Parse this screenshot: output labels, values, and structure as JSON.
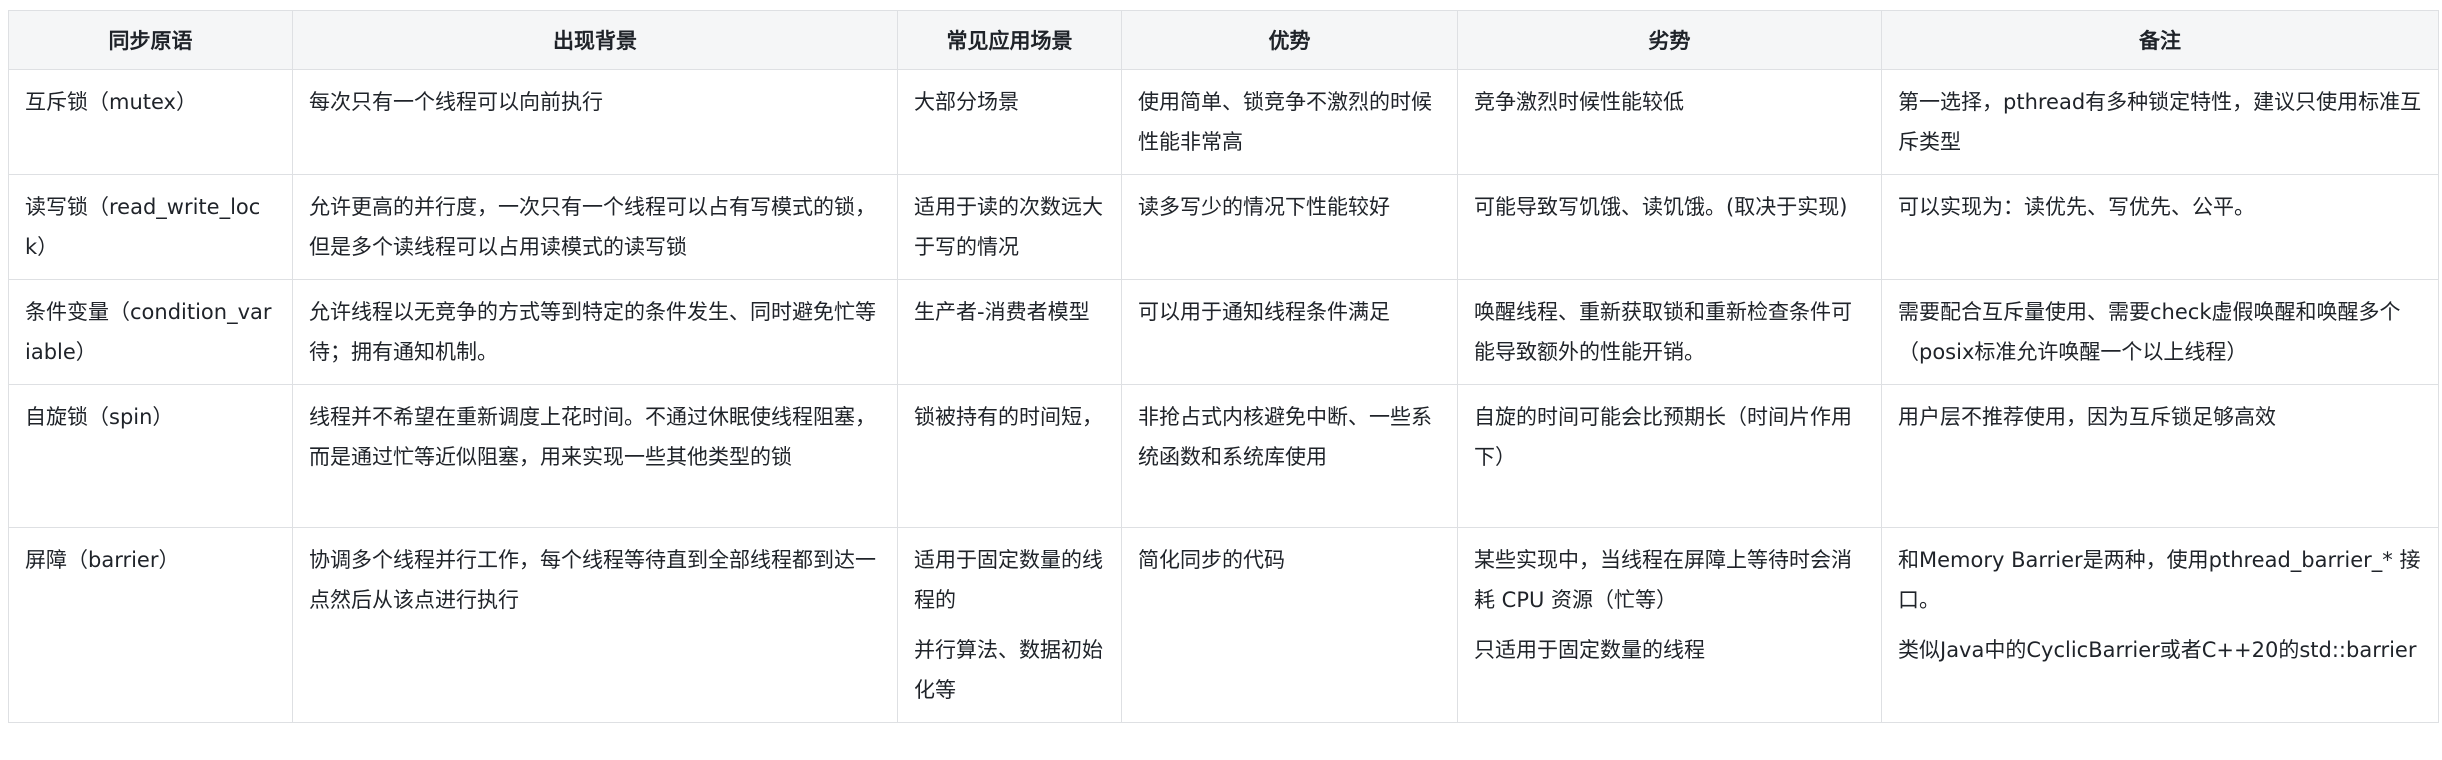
{
  "table": {
    "headers": [
      "同步原语",
      "出现背景",
      "常见应用场景",
      "优势",
      "劣势",
      "备注"
    ],
    "rows": [
      [
        [
          "互斥锁（mutex）"
        ],
        [
          "每次只有一个线程可以向前执行"
        ],
        [
          "大部分场景"
        ],
        [
          "使用简单、锁竞争不激烈的时候性能非常高"
        ],
        [
          "竞争激烈时候性能较低"
        ],
        [
          "第一选择，pthread有多种锁定特性，建议只使用标准互斥类型"
        ]
      ],
      [
        [
          "读写锁（read_write_lock）"
        ],
        [
          "允许更高的并行度，一次只有一个线程可以占有写模式的锁，但是多个读线程可以占用读模式的读写锁"
        ],
        [
          "适用于读的次数远大于写的情况"
        ],
        [
          "读多写少的情况下性能较好"
        ],
        [
          "可能导致写饥饿、读饥饿。(取决于实现)"
        ],
        [
          "可以实现为：读优先、写优先、公平。"
        ]
      ],
      [
        [
          "条件变量（condition_variable）"
        ],
        [
          "允许线程以无竞争的方式等到特定的条件发生、同时避免忙等待；拥有通知机制。"
        ],
        [
          "生产者-消费者模型"
        ],
        [
          "可以用于通知线程条件满足"
        ],
        [
          "唤醒线程、重新获取锁和重新检查条件可能导致额外的性能开销。"
        ],
        [
          "需要配合互斥量使用、需要check虚假唤醒和唤醒多个（posix标准允许唤醒一个以上线程）"
        ]
      ],
      [
        [
          "自旋锁（spin）"
        ],
        [
          "线程并不希望在重新调度上花时间。不通过休眠使线程阻塞，而是通过忙等近似阻塞，用来实现一些其他类型的锁"
        ],
        [
          "锁被持有的时间短，"
        ],
        [
          "非抢占式内核避免中断、一些系统函数和系统库使用"
        ],
        [
          "自旋的时间可能会比预期长（时间片作用下）"
        ],
        [
          "用户层不推荐使用，因为互斥锁足够高效"
        ]
      ],
      [
        [
          "屏障（barrier）"
        ],
        [
          "协调多个线程并行工作，每个线程等待直到全部线程都到达一点然后从该点进行执行"
        ],
        [
          "适用于固定数量的线程的",
          "并行算法、数据初始化等"
        ],
        [
          "简化同步的代码"
        ],
        [
          "某些实现中，当线程在屏障上等待时会消耗 CPU 资源（忙等）",
          "只适用于固定数量的线程"
        ],
        [
          "和Memory Barrier是两种，使用pthread_barrier_* 接口。",
          "类似Java中的CyclicBarrier或者C++20的std::barrier"
        ]
      ]
    ]
  }
}
